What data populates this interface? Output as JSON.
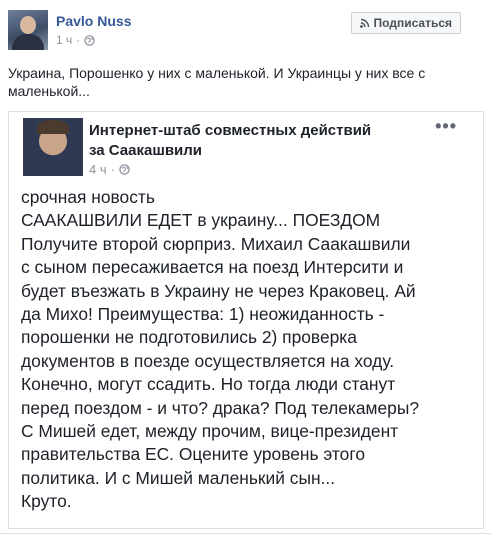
{
  "post": {
    "author": "Pavlo Nuss",
    "time": "1 ч",
    "subscribe_label": "Подписаться",
    "text": "Украина, Порошенко у них с маленькой. И Украинцы у них все с маленькой..."
  },
  "shared_post": {
    "author": "Интернет-штаб совместных действий за Саакашвили",
    "time": "4 ч",
    "more": "•••",
    "body_lines": [
      "срочная новость",
      "САAКАШВИЛИ ЕДЕТ в украину... ПОЕЗДОМ",
      "Получите второй сюрприз. Михаил Саакашвили",
      "с сыном пересаживается на поезд Интерсити и",
      "будет въезжать в Украину не через Краковец. Ай",
      "да Михо! Преимущества: 1) неожиданность -",
      "порошенки не подготовились 2) проверка",
      "документов в поезде осуществляется на ходу.",
      "Конечно, могут ссадить. Но тогда люди станут",
      "перед поездом - и что? драка? Под телекамеры?",
      "С Мишей едет, между прочим, вице-президент",
      "правительства ЕС. Оцените уровень этого",
      "политика. И с Мишей маленький сын...",
      "Круто."
    ]
  },
  "icons": {
    "globe": "globe-icon",
    "rss": "rss-icon",
    "more": "more-options-icon"
  },
  "colors": {
    "link_blue": "#365899",
    "meta_gray": "#90949c",
    "border": "#dddfe2"
  }
}
